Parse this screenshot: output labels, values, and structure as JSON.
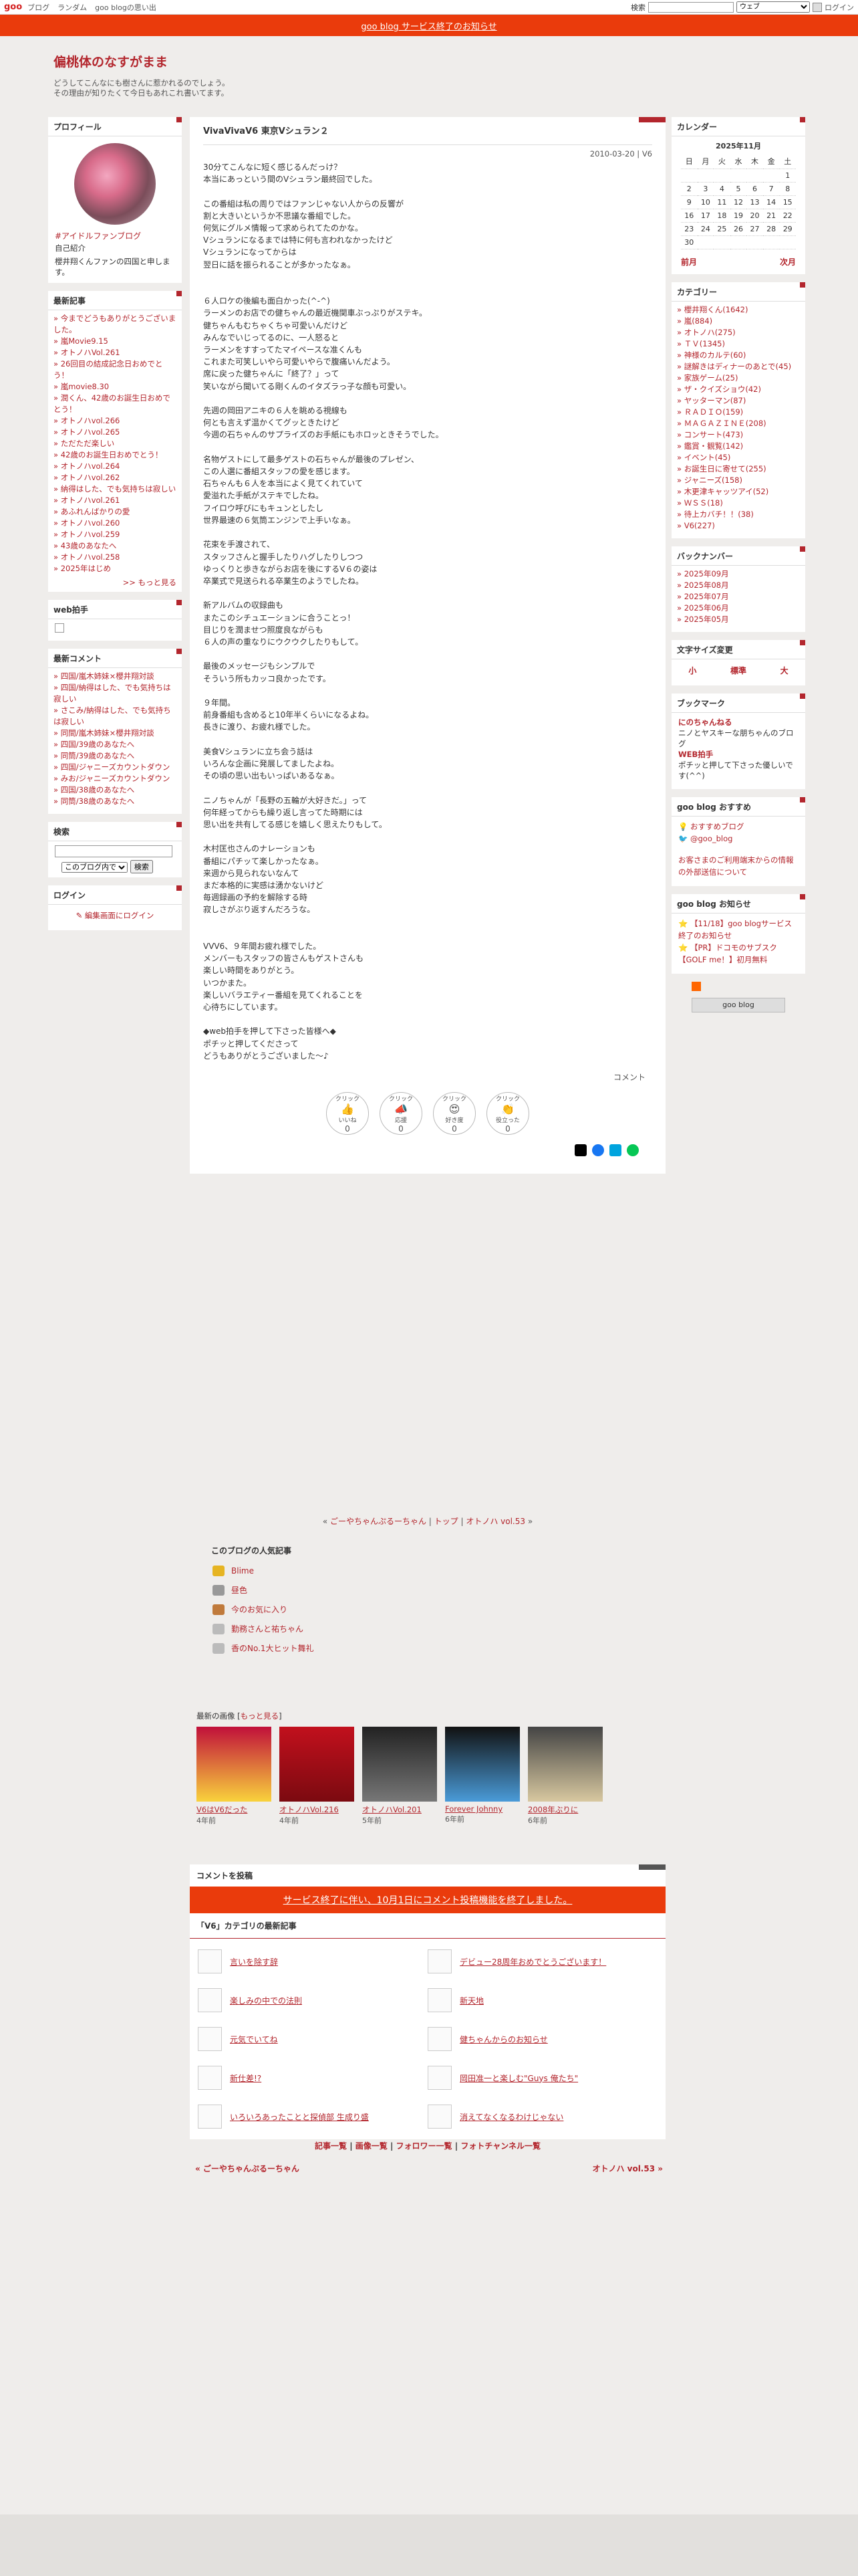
{
  "topbar": {
    "logo": "goo",
    "links": [
      "ブログ",
      "ランダム",
      "goo blogの思い出"
    ],
    "search_label": "検索",
    "search_option": "ウェブ",
    "login": "ログイン"
  },
  "notice": "goo blog サービス終了のお知らせ",
  "blog": {
    "title": "偏桃体のなすがまま",
    "desc1": "どうしてこんなにも樹さんに惹かれるのでしょう。",
    "desc2": "その理由が知りたくて今日もあれこれ書いてます。"
  },
  "profile": {
    "head": "プロフィール",
    "link": "#アイドルファンブログ",
    "intro": "自己紹介",
    "text": "櫻井翔くんファンの四国と申します。"
  },
  "recent": {
    "head": "最新記事",
    "items": [
      "今までどうもありがとうございました。",
      "嵐Movie9.15",
      "オトノハVol.261",
      "26回目の結成記念日おめでとう！",
      "嵐movie8.30",
      "潤くん、42歳のお誕生日おめでとう！",
      "オトノハvol.266",
      "オトノハvol.265",
      "ただただ楽しい",
      "42歳のお誕生日おめでとう！",
      "オトノハvol.264",
      "オトノハvol.262",
      "納得はした、でも気持ちは寂しい",
      "オトノハvol.261",
      "あふれんばかりの愛",
      "オトノハvol.260",
      "オトノハvol.259",
      "43歳のあなたへ",
      "オトノハvol.258",
      "2025年はじめ"
    ],
    "more": ">> もっと見る"
  },
  "webclap": {
    "head": "web拍手"
  },
  "comments": {
    "head": "最新コメント",
    "items": [
      "四国/嵐木姉妹×櫻井翔対談",
      "四国/納得はした、でも気持ちは寂しい",
      "さこみ/納得はした、でも気持ちは寂しい",
      "同間/嵐木姉妹×櫻井翔対談",
      "四国/39歳のあなたへ",
      "同筒/39歳のあなたへ",
      "四国/ジャニーズカウントダウン",
      "みお/ジャニーズカウントダウン",
      "四国/38歳のあなたへ",
      "同筒/38歳のあなたへ"
    ]
  },
  "search": {
    "head": "検索",
    "select": "このブログ内で",
    "button": "検索"
  },
  "login": {
    "head": "ログイン",
    "link": "編集画面にログイン"
  },
  "entry": {
    "title": "VivaVivaV6 東京Vシュラン２",
    "date": "2010-03-20 | V6",
    "body": "30分てこんなに短く感じるんだっけ？\n本当にあっという間のVシュラン最終回でした。\n\nこの番組は私の周りではファンじゃない人からの反響が\n割と大きいというか不思議な番組でした。\n何気にグルメ情報って求められてたのかな。\nVシュランになるまでは特に何も言われなかったけど\nVシュランになってからは\n翌日に話を振られることが多かったなぁ。\n\n\n６人ロケの後編も面白かった(^-^)\nラーメンのお店での健ちゃんの最近機関車ぶっぷりがステキ。\n健ちゃんもむちゃくちゃ可愛いんだけど\nみんなでいじってるのに、一人怒ると\nラーメンをすすってたマイペースな准くんも\nこれまた可笑しいやら可愛いやらで腹痛いんだよう。\n席に戻った健ちゃんに「終了？」って\n笑いながら聞いてる剛くんのイタズラっ子な顔も可愛い。\n\n先週の岡田アニキの６人を眺める視線も\n何とも言えず温かくてグッときたけど\n今週の石ちゃんのサプライズのお手紙にもホロッときそうでした。\n\n名物ゲストにして最多ゲストの石ちゃんが最後のプレゼン、\nこの人選に番組スタッフの愛を感じます。\n石ちゃんも６人を本当によく見てくれていて\n愛溢れた手紙がステキでしたね。\nフイロウ呼びにもキュンとしたし\n世界最速の６気筒エンジンで上手いなぁ。\n\n花束を手渡されて、\nスタッフさんと握手したりハグしたりしつつ\nゆっくりと歩きながらお店を後にするV６の姿は\n卒業式で見送られる卒業生のようでしたね。\n\n新アルバムの収録曲も\nまたこのシチュエーションに合うことっ！\n目じりを潤ませつ照度良ながらも\n６人の声の重なりにウクウクしたりもして。\n\n最後のメッセージもシンプルで\nそういう所もカッコ良かったです。\n\n９年間。\n前身番組も含めると10年半くらいになるよね。\n長きに渡り、お疲れ様でした。\n\n美食Vシュランに立ち会う話は\nいろんな企画に発展してましたよね。\nその頃の思い出もいっぱいあるなぁ。\n\nニノちゃんが「長野の五輪が大好きだ。」って\n何年経ってからも繰り返し言ってた時期には\n思い出を共有してる感じを嬉しく思えたりもして。\n\n木村匡也さんのナレーションも\n番組にパチッて楽しかったなぁ。\n来週から見られないなんて\nまだ本格的に実感は湧かないけど\n毎週録画の予約を解除する時\n寂しさがぶり返すんだろうな。\n\n\nVVV6、９年間お疲れ様でした。\nメンバーもスタッフの皆さんもゲストさんも\n楽しい時間をありがとう。\nいつかまた。\n楽しいバラエティー番組を見てくれることを\n心待ちにしています。\n\n◆web拍手を押して下さった皆様へ◆\nポチッと押してくださって\nどうもありがとうございました～♪",
    "meta": "コメント",
    "reactions": [
      {
        "label": "いいね",
        "top": "クリック",
        "emoji": "👍",
        "count": "0"
      },
      {
        "label": "応援",
        "top": "クリック",
        "emoji": "📣",
        "count": "0"
      },
      {
        "label": "好き度",
        "top": "クリック",
        "emoji": "😍",
        "count": "0"
      },
      {
        "label": "役立った",
        "top": "クリック",
        "emoji": "👏",
        "count": "0"
      }
    ]
  },
  "nav": {
    "prev": "ごーやちゃんぷるーちゃん",
    "top": "トップ",
    "next": "オトノハ vol.53"
  },
  "popular": {
    "head": "このブログの人気記事",
    "items": [
      "Blime",
      "昼色",
      "今のお気に入り",
      "勤務さんと祐ちゃん",
      "香のNo.1大ヒット舞礼"
    ]
  },
  "images": {
    "head": "最新の画像",
    "more": "もっと見る",
    "items": [
      {
        "cap": "V6はV6だった",
        "ago": "4年前"
      },
      {
        "cap": "オトノハVol.216",
        "ago": "4年前"
      },
      {
        "cap": "オトノハVol.201",
        "ago": "5年前"
      },
      {
        "cap": "Forever Johnny",
        "ago": "6年前"
      },
      {
        "cap": "2008年ぶりに",
        "ago": "6年前"
      }
    ]
  },
  "post": {
    "head": "コメントを投稿",
    "notice": "サービス終了に伴い、10月1日にコメント投稿機能を終了しました。"
  },
  "category_recent": {
    "head": "「V6」カテゴリの最新記事",
    "items": [
      "言いを除す辞",
      "デビュー28周年おめでとうございます！",
      "楽しみの中での法則",
      "新天地",
      "元気でいてね",
      "健ちゃんからのお知らせ",
      "新仕差!?",
      "岡田准一と楽しむ\"Guys 俺たち\"",
      "いろいろあったことと探偵部 生成り盛",
      "消えてなくなるわけじゃない"
    ]
  },
  "footer": {
    "links": [
      "記事一覧",
      "画像一覧",
      "フォロワー一覧",
      "フォトチャンネル一覧"
    ],
    "prev": "« ごーやちゃんぷるーちゃん",
    "next": "オトノハ vol.53 »"
  },
  "calendar": {
    "head": "カレンダー",
    "month": "2025年11月",
    "days": [
      "日",
      "月",
      "火",
      "水",
      "木",
      "金",
      "土"
    ],
    "prev": "前月",
    "next": "次月"
  },
  "categories": {
    "head": "カテゴリー",
    "items": [
      "櫻井翔くん(1642)",
      "嵐(884)",
      "オトノハ(275)",
      "ＴＶ(1345)",
      "神様のカルテ(60)",
      "謎解きはディナーのあとで(45)",
      "家族ゲーム(25)",
      "ザ・クイズショウ(42)",
      "ヤッターマン(87)",
      "ＲＡＤＩＯ(159)",
      "ＭＡＧＡＺＩＮＥ(208)",
      "コンサート(473)",
      "鑑賞・観覧(142)",
      "イベント(45)",
      "お誕生日に寄せて(255)",
      "ジャニーズ(158)",
      "木更津キャッツアイ(52)",
      "ＷＳＳ(18)",
      "待上カバチ！！(38)",
      "V6(227)"
    ]
  },
  "backnumber": {
    "head": "バックナンバー",
    "items": [
      "2025年09月",
      "2025年08月",
      "2025年07月",
      "2025年06月",
      "2025年05月"
    ]
  },
  "textsize": {
    "head": "文字サイズ変更",
    "small": "小",
    "normal": "標準",
    "large": "大"
  },
  "bookmark": {
    "head": "ブックマーク",
    "n1": "にのちゃんねる",
    "d1": "ニノとヤスキーな朋ちゃんのブログ",
    "n2": "WEB拍手",
    "d2": "ポチッと押して下さった優しいです(^^)"
  },
  "gooreco": {
    "head": "goo blog おすすめ",
    "a": "おすすめブログ",
    "b": "@goo_blog",
    "c": "お客さまのご利用端末からの情報の外部送信について"
  },
  "goonews": {
    "head": "goo blog お知らせ",
    "a": "【11/18】goo blogサービス終了のお知らせ",
    "b": "【PR】ドコモのサブスク【GOLF me！】初月無料"
  },
  "goologo": "goo blog"
}
